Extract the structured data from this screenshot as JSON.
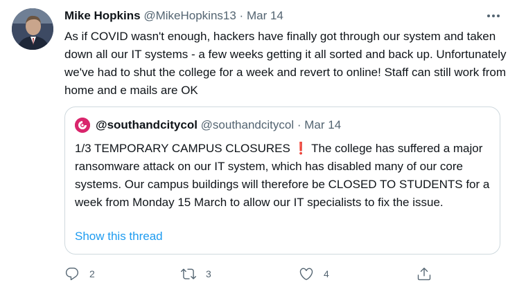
{
  "tweet": {
    "author": "Mike Hopkins",
    "handle": "@MikeHopkins13",
    "separator": "·",
    "date": "Mar 14",
    "text": "As if COVID wasn't enough, hackers have finally got through our system and taken down all our IT systems - a few weeks getting it all sorted and back up. Unfortunately we've had to shut the college for a week and revert to online! Staff can still work from home and e mails are OK",
    "more_icon": "more-horizontal-icon"
  },
  "quoted": {
    "author": "@southandcitycol",
    "handle": "@southandcitycol",
    "separator": "·",
    "date": "Mar 14",
    "text": "1/3 TEMPORARY CAMPUS CLOSURES ❗ The college has suffered a major ransomware attack on our IT system, which has disabled many of our core systems. Our campus buildings will therefore be CLOSED TO STUDENTS for a week from Monday 15 March to allow our IT specialists to fix the issue.",
    "show_thread": "Show this thread",
    "avatar_color": "#d9256c"
  },
  "actions": {
    "replies": "2",
    "retweets": "3",
    "likes": "4"
  }
}
